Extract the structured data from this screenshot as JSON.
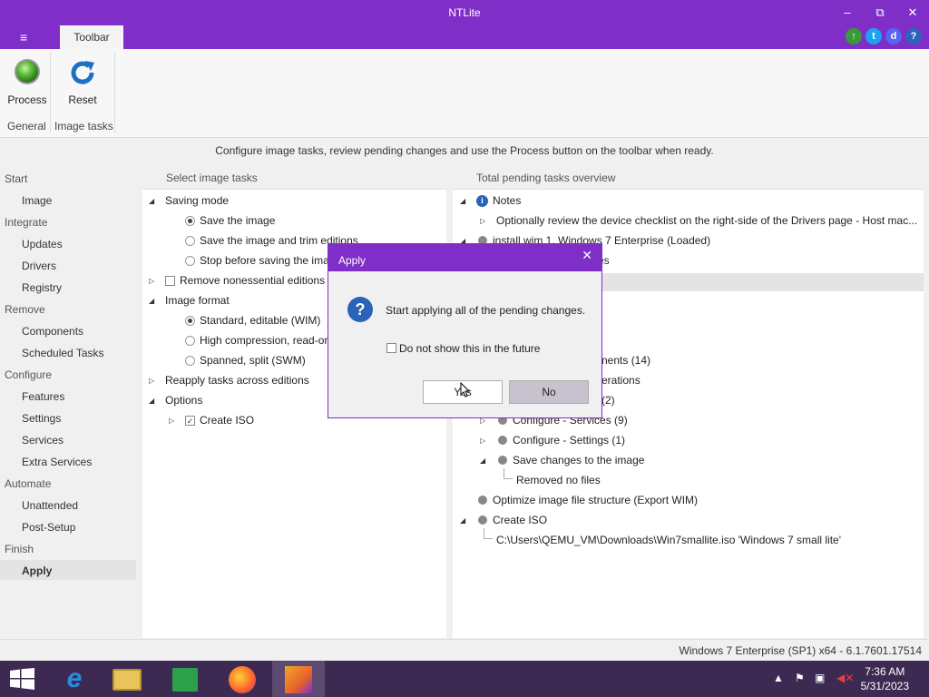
{
  "window": {
    "title": "NTLite",
    "minimize": "–",
    "maximize": "⧉",
    "close": "✕"
  },
  "ribbon": {
    "menu_glyph": "≡",
    "tab_label": "Toolbar",
    "buttons": [
      {
        "label": "Process"
      },
      {
        "label": "Reset"
      }
    ],
    "groups": [
      "General",
      "Image tasks"
    ]
  },
  "infobar": "Configure image tasks, review pending changes and use the Process button on the toolbar when ready.",
  "sidebar": {
    "sections": [
      {
        "label": "Start",
        "items": [
          "Image"
        ]
      },
      {
        "label": "Integrate",
        "items": [
          "Updates",
          "Drivers",
          "Registry"
        ]
      },
      {
        "label": "Remove",
        "items": [
          "Components",
          "Scheduled Tasks"
        ]
      },
      {
        "label": "Configure",
        "items": [
          "Features",
          "Settings",
          "Services",
          "Extra Services"
        ]
      },
      {
        "label": "Automate",
        "items": [
          "Unattended",
          "Post-Setup"
        ]
      },
      {
        "label": "Finish",
        "items": [
          "Apply"
        ]
      }
    ],
    "active": "Apply"
  },
  "left_panel": {
    "header": "Select image tasks",
    "saving_mode": "Saving mode",
    "save_image": "Save the image",
    "save_trim": "Save the image and trim editions",
    "stop_before": "Stop before saving the ima",
    "remove_nonessential": "Remove nonessential editions",
    "image_format": "Image format",
    "fmt_standard": "Standard, editable (WIM)",
    "fmt_high": "High compression, read-or",
    "fmt_spanned": "Spanned, split (SWM)",
    "reapply": "Reapply tasks across editions",
    "options": "Options",
    "create_iso": "Create ISO"
  },
  "right_panel": {
    "header": "Total pending tasks overview",
    "notes": "Notes",
    "note_text": "Optionally review the device checklist on the right-side of the Drivers page - Host mac...",
    "install_wim": "install.wim 1. Windows 7 Enterprise  (Loaded)",
    "partial_es": "es",
    "partial_components": "nents (14)",
    "partial_operations": "erations",
    "partial_count": "(2)",
    "services": "Configure - Services (9)",
    "settings": "Configure - Settings (1)",
    "save_changes": "Save changes to the image",
    "removed_no_files": "Removed no files",
    "optimize": "Optimize image file structure (Export WIM)",
    "create_iso": "Create ISO",
    "iso_path": "C:\\Users\\QEMU_VM\\Downloads\\Win7smallite.iso 'Windows 7 small lite'"
  },
  "dialog": {
    "title": "Apply",
    "close": "✕",
    "message": "Start applying all of the pending changes.",
    "checkbox_label": "Do not show this in the future",
    "yes_label": "Yes",
    "no_label": "No"
  },
  "status": "Windows 7 Enterprise (SP1) x64 - 6.1.7601.17514",
  "taskbar": {
    "time": "7:36 AM",
    "date": "5/31/2023"
  },
  "colors": {
    "accent": "#7f2ec7",
    "taskbar": "#3d2a52"
  }
}
